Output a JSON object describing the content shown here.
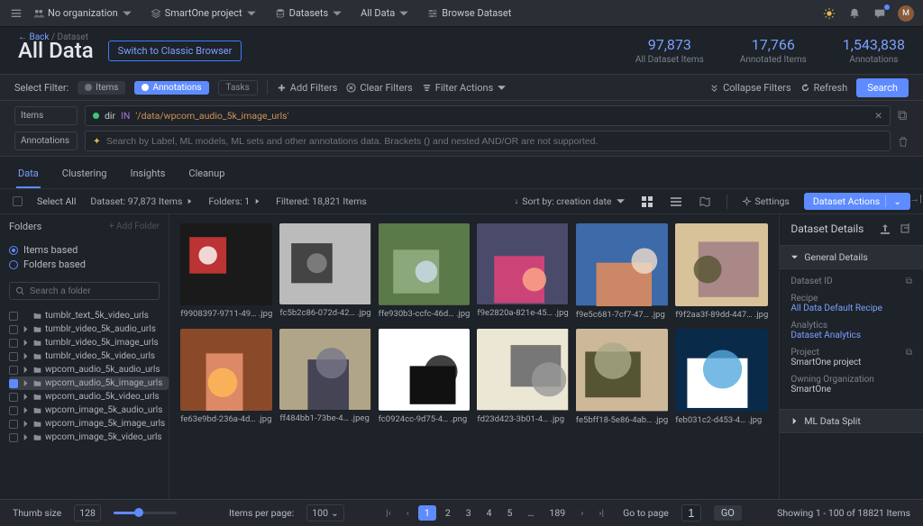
{
  "topbar": {
    "org_label": "No organization",
    "project_label": "SmartOne project",
    "nav1": "Datasets",
    "nav2": "All Data",
    "nav3": "Browse Dataset",
    "avatar_letter": "M"
  },
  "crumbs": {
    "back": "← Back",
    "trail": "/ Dataset"
  },
  "title": "All Data",
  "switch_btn": "Switch to Classic Browser",
  "stats": [
    {
      "num": "97,873",
      "lbl": "All Dataset Items"
    },
    {
      "num": "17,766",
      "lbl": "Annotated Items"
    },
    {
      "num": "1,543,838",
      "lbl": "Annotations"
    }
  ],
  "filterbar": {
    "label": "Select Filter:",
    "items": "Items",
    "annotations": "Annotations",
    "tasks": "Tasks",
    "add_filters": "Add Filters",
    "clear_filters": "Clear Filters",
    "filter_actions": "Filter Actions",
    "collapse": "Collapse Filters",
    "refresh": "Refresh",
    "search": "Search"
  },
  "query": {
    "items_tag": "Items",
    "annotations_tag": "Annotations",
    "dir": "dir",
    "op": "IN",
    "val": "'/data/wpcom_audio_5k_image_urls'",
    "ann_placeholder": "Search by Label, ML models, ML sets and other annotations data. Brackets () and nested AND/OR are not supported."
  },
  "tabs": [
    "Data",
    "Clustering",
    "Insights",
    "Cleanup"
  ],
  "status": {
    "select_all": "Select All",
    "dataset": "Dataset: 97,873 Items",
    "folders": "Folders: 1",
    "filtered": "Filtered: 18,821 Items",
    "sort": "Sort by: creation date",
    "settings": "Settings",
    "dataset_actions": "Dataset Actions"
  },
  "folders": {
    "title": "Folders",
    "add": "Add Folder",
    "items_based": "Items based",
    "folders_based": "Folders based",
    "search_placeholder": "Search a folder",
    "list": [
      "tumblr_text_5k_video_urls",
      "tumblr_video_5k_audio_urls",
      "tumblr_video_5k_image_urls",
      "tumblr_video_5k_video_urls",
      "wpcom_audio_5k_audio_urls",
      "wpcom_audio_5k_image_urls",
      "wpcom_audio_5k_video_urls",
      "wpcom_image_5k_audio_urls",
      "wpcom_image_5k_image_urls",
      "wpcom_image_5k_video_urls"
    ],
    "selected_index": 5
  },
  "items": [
    "f9908397-9711-49…  .jpg",
    "fc5b2c86-072d-42…  .jpg",
    "ffe930b3-ccfc-46d…  .jpg",
    "f9e2820a-821e-45…  .jpg",
    "f9e5c681-7cf7-47…  .jpg",
    "f9f2aa3f-89dd-447…  .jpg",
    "fe63e9bd-236a-4d…  .jpg",
    "ff484bb1-73be-4…  .jpeg",
    "fc0924cc-9d75-4…  .png",
    "fd23d423-3b01-4…  .jpg",
    "fe5bff18-5e86-4ab…  .jpg",
    "feb031c2-d453-4…  .jpg"
  ],
  "details": {
    "title": "Dataset Details",
    "general": "General Details",
    "dataset_id": "Dataset ID",
    "recipe": "Recipe",
    "recipe_val": "All Data Default Recipe",
    "analytics": "Analytics",
    "analytics_val": "Dataset Analytics",
    "project": "Project",
    "project_val": "SmartOne project",
    "owning": "Owning Organization",
    "owning_val": "SmartOne",
    "ml_split": "ML Data Split"
  },
  "footer": {
    "thumb": "Thumb size",
    "thumb_val": "128",
    "ipp": "Items per page:",
    "ipp_val": "100",
    "pages": [
      "1",
      "2",
      "3",
      "4",
      "5",
      "…",
      "189"
    ],
    "goto": "Go to page",
    "goto_val": "1",
    "go": "GO",
    "showing": "Showing 1 - 100 of 18821 Items"
  }
}
